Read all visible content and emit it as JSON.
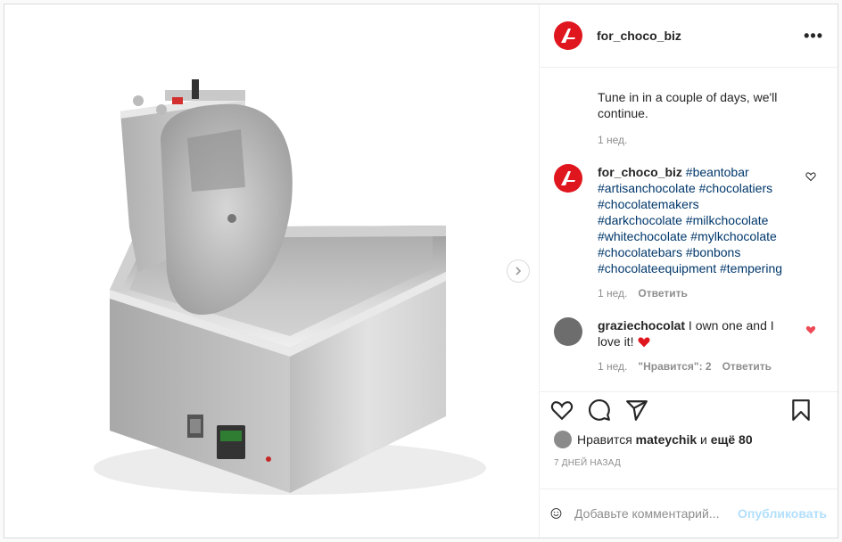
{
  "post": {
    "username": "for_choco_biz",
    "more_icon": "•••",
    "next_icon": "chevron-right-icon"
  },
  "comments": [
    {
      "username": "",
      "text": "Tune in in a couple of days, we'll continue.",
      "time": "1 нед."
    },
    {
      "username": "for_choco_biz",
      "text": "#beantobar #artisanchocolate #chocolatiers #chocolatemakers #darkchocolate #milkchocolate #whitechocolate #mylkchocolate #chocolatebars #bonbons #chocolateequipment #tempering",
      "time": "1 нед.",
      "reply": "Ответить"
    },
    {
      "username": "graziechocolat",
      "text": "I own one and I love it!",
      "time": "1 нед.",
      "likes": "\"Нравится\": 2",
      "reply": "Ответить"
    }
  ],
  "likes": {
    "prefix": "Нравится",
    "user": "mateychik",
    "and": "и",
    "rest": "ещё 80"
  },
  "date": "7 ДНЕЙ НАЗАД",
  "add_comment": {
    "placeholder": "Добавьте комментарий...",
    "publish": "Опубликовать"
  },
  "colors": {
    "brand": "#e0161e",
    "like_red": "#ed4956",
    "link": "#00376b",
    "publish_disabled": "#b2dffc"
  }
}
